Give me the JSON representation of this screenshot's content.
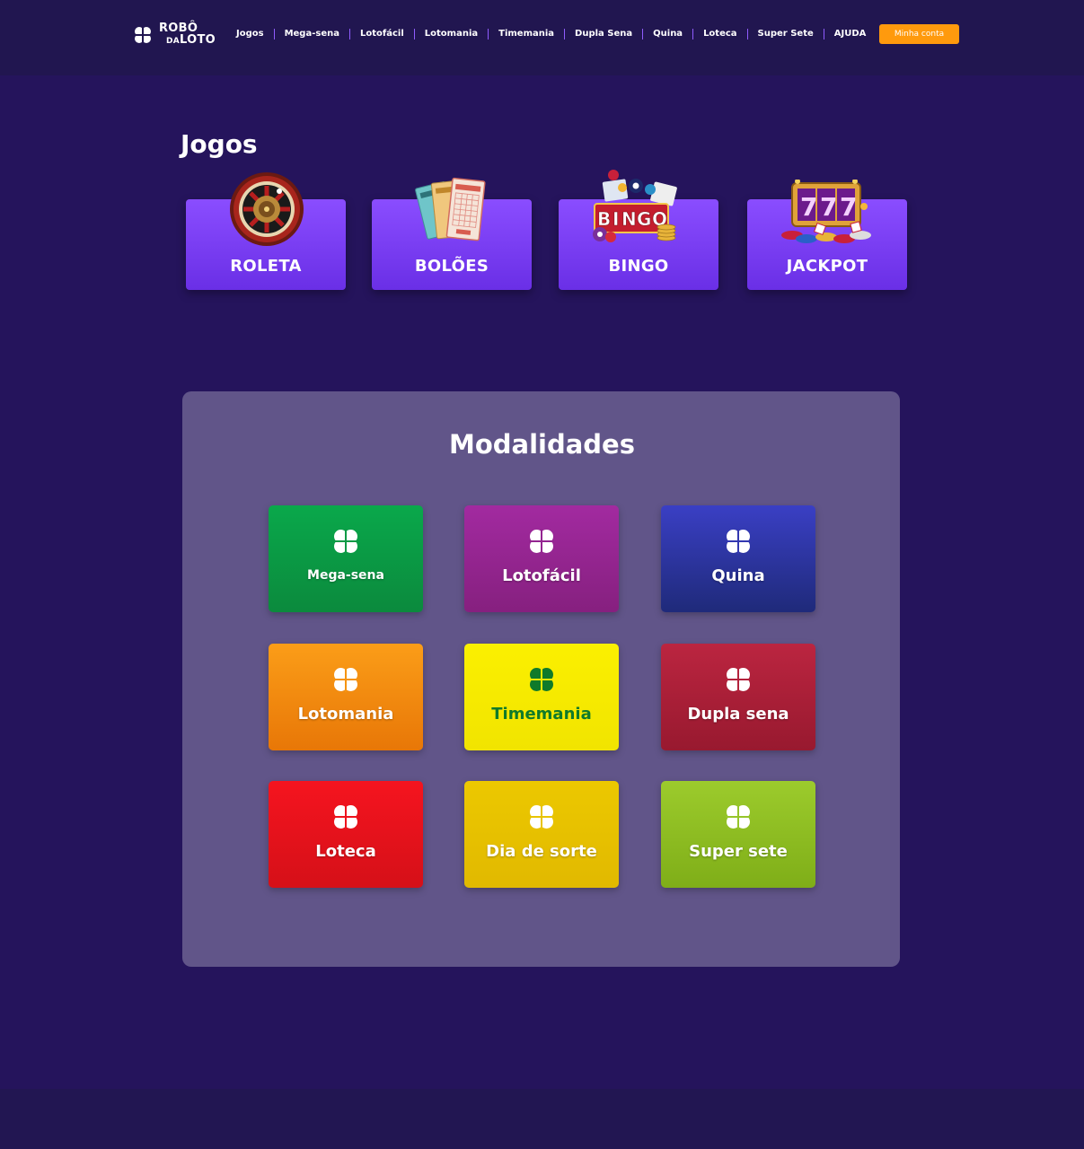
{
  "header": {
    "logo_line1": "ROBÔ",
    "logo_da": "DA",
    "logo_line2": "LOTO",
    "nav": [
      "Jogos",
      "Mega-sena",
      "Lotofácil",
      "Lotomania",
      "Timemania",
      "Dupla Sena",
      "Quina",
      "Loteca",
      "Super Sete",
      "AJUDA"
    ],
    "account_label": "Minha conta",
    "account_color": "#ff9a0d"
  },
  "jogos": {
    "title": "Jogos",
    "cards": [
      "ROLETA",
      "BOLÕES",
      "BINGO",
      "JACKPOT"
    ]
  },
  "modalidades": {
    "title": "Modalidades",
    "items": [
      {
        "label": "Mega-sena",
        "color": "#0b9a45"
      },
      {
        "label": "Lotofácil",
        "color": "#932590"
      },
      {
        "label": "Quina",
        "color": "#2a2f9a"
      },
      {
        "label": "Lotomania",
        "color": "#f2860d"
      },
      {
        "label": "Timemania",
        "color": "#f6ea00"
      },
      {
        "label": "Dupla sena",
        "color": "#a91f3a"
      },
      {
        "label": "Loteca",
        "color": "#e0141d"
      },
      {
        "label": "Dia de sorte",
        "color": "#e4bf00"
      },
      {
        "label": "Super sete",
        "color": "#8dba22"
      }
    ]
  }
}
